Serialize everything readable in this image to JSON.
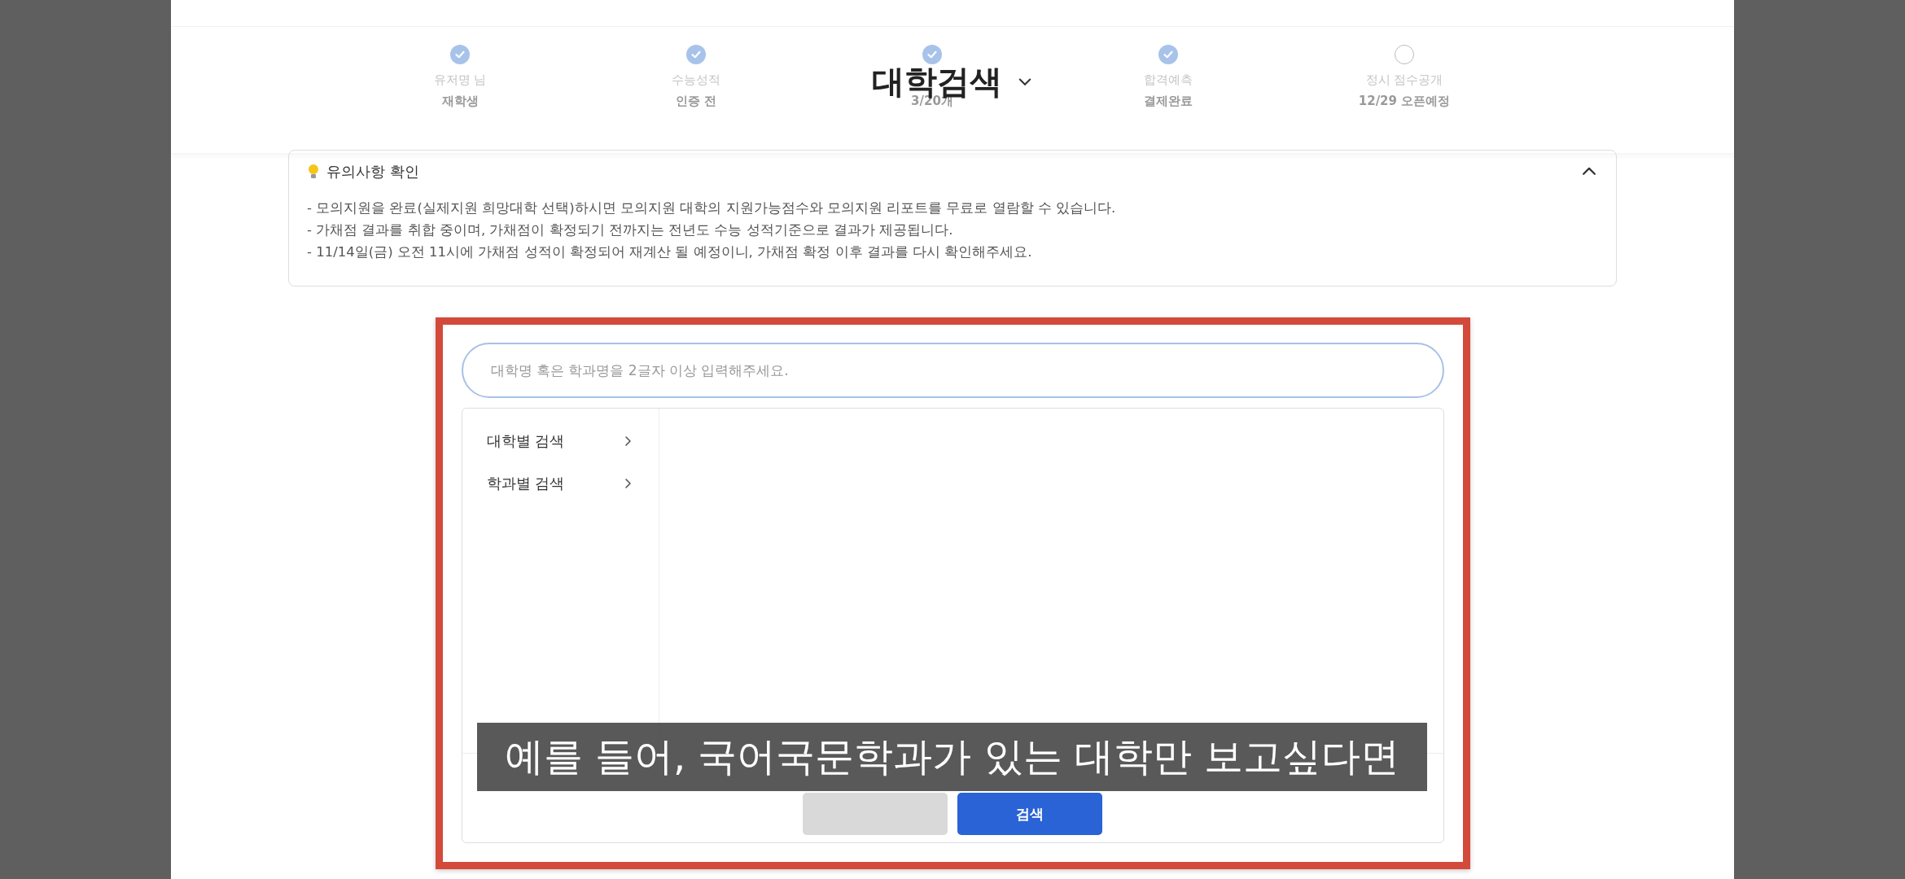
{
  "page_title": "대학검색",
  "steps": [
    {
      "label": "유저명 님",
      "value": "재학생",
      "done": true
    },
    {
      "label": "수능성적",
      "value": "인증 전",
      "done": true
    },
    {
      "value": "3/20개",
      "done": true
    },
    {
      "label": "합격예측",
      "value": "결제완료",
      "done": true
    },
    {
      "label": "정시 점수공개",
      "value": "12/29 오픈예정",
      "done": false
    }
  ],
  "notice": {
    "title": "유의사항 확인",
    "expanded": true,
    "items": [
      "- 모의지원을 완료(실제지원 희망대학 선택)하시면 모의지원 대학의 지원가능점수와 모의지원 리포트를 무료로 열람할 수 있습니다.",
      "- 가채점 결과를 취합 중이며, 가채점이 확정되기 전까지는 전년도 수능 성적기준으로 결과가 제공됩니다.",
      "- 11/14일(금) 오전 11시에 가채점 성적이 확정되어 재계산 될 예정이니, 가채점 확정 이후 결과를 다시 확인해주세요."
    ]
  },
  "search": {
    "placeholder": "대학명 혹은 학과명을 2글자 이상 입력해주세요."
  },
  "menu": [
    {
      "label": "대학별 검색"
    },
    {
      "label": "학과별 검색"
    }
  ],
  "buttons": [
    {
      "kind": "secondary"
    },
    {
      "label": "검색",
      "kind": "primary"
    }
  ],
  "caption": "예를 들어, 국어국문학과가 있는 대학만 보고싶다면"
}
